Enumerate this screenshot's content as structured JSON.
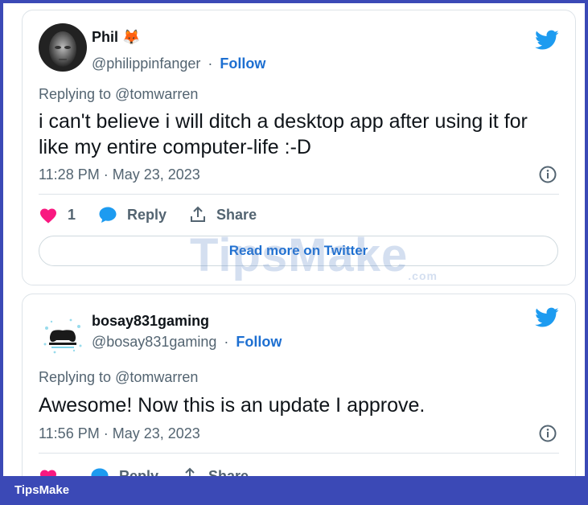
{
  "tweets": [
    {
      "name": "Phil",
      "name_emoji": "🦊",
      "handle": "@philippinfanger",
      "follow_label": "Follow",
      "separator": "·",
      "replying_prefix": "Replying to",
      "replying_handle": "@tomwarren",
      "text": "i can't believe i will ditch a desktop app after using it for like my entire computer-life :-D",
      "timestamp": "11:28 PM · May 23, 2023",
      "like_count": "1",
      "reply_label": "Reply",
      "share_label": "Share",
      "read_more_label": "Read more on Twitter"
    },
    {
      "name": "bosay831gaming",
      "handle": "@bosay831gaming",
      "follow_label": "Follow",
      "separator": "·",
      "replying_prefix": "Replying to",
      "replying_handle": "@tomwarren",
      "text": "Awesome! Now this is an update I approve.",
      "timestamp": "11:56 PM · May 23, 2023",
      "reply_label": "Reply",
      "share_label": "Share"
    }
  ],
  "watermark": {
    "text": "TipsMake",
    "suffix": ".com"
  },
  "footer": {
    "brand": "TipsMake"
  },
  "colors": {
    "twitter_blue": "#1d9bf0",
    "follow_blue": "#1d6fd1",
    "like_pink": "#f91880",
    "border_frame": "#3b49b6"
  },
  "icons": [
    "twitter-bird-icon",
    "info-icon",
    "heart-icon",
    "reply-bubble-icon",
    "share-icon",
    "fox-emoji"
  ]
}
